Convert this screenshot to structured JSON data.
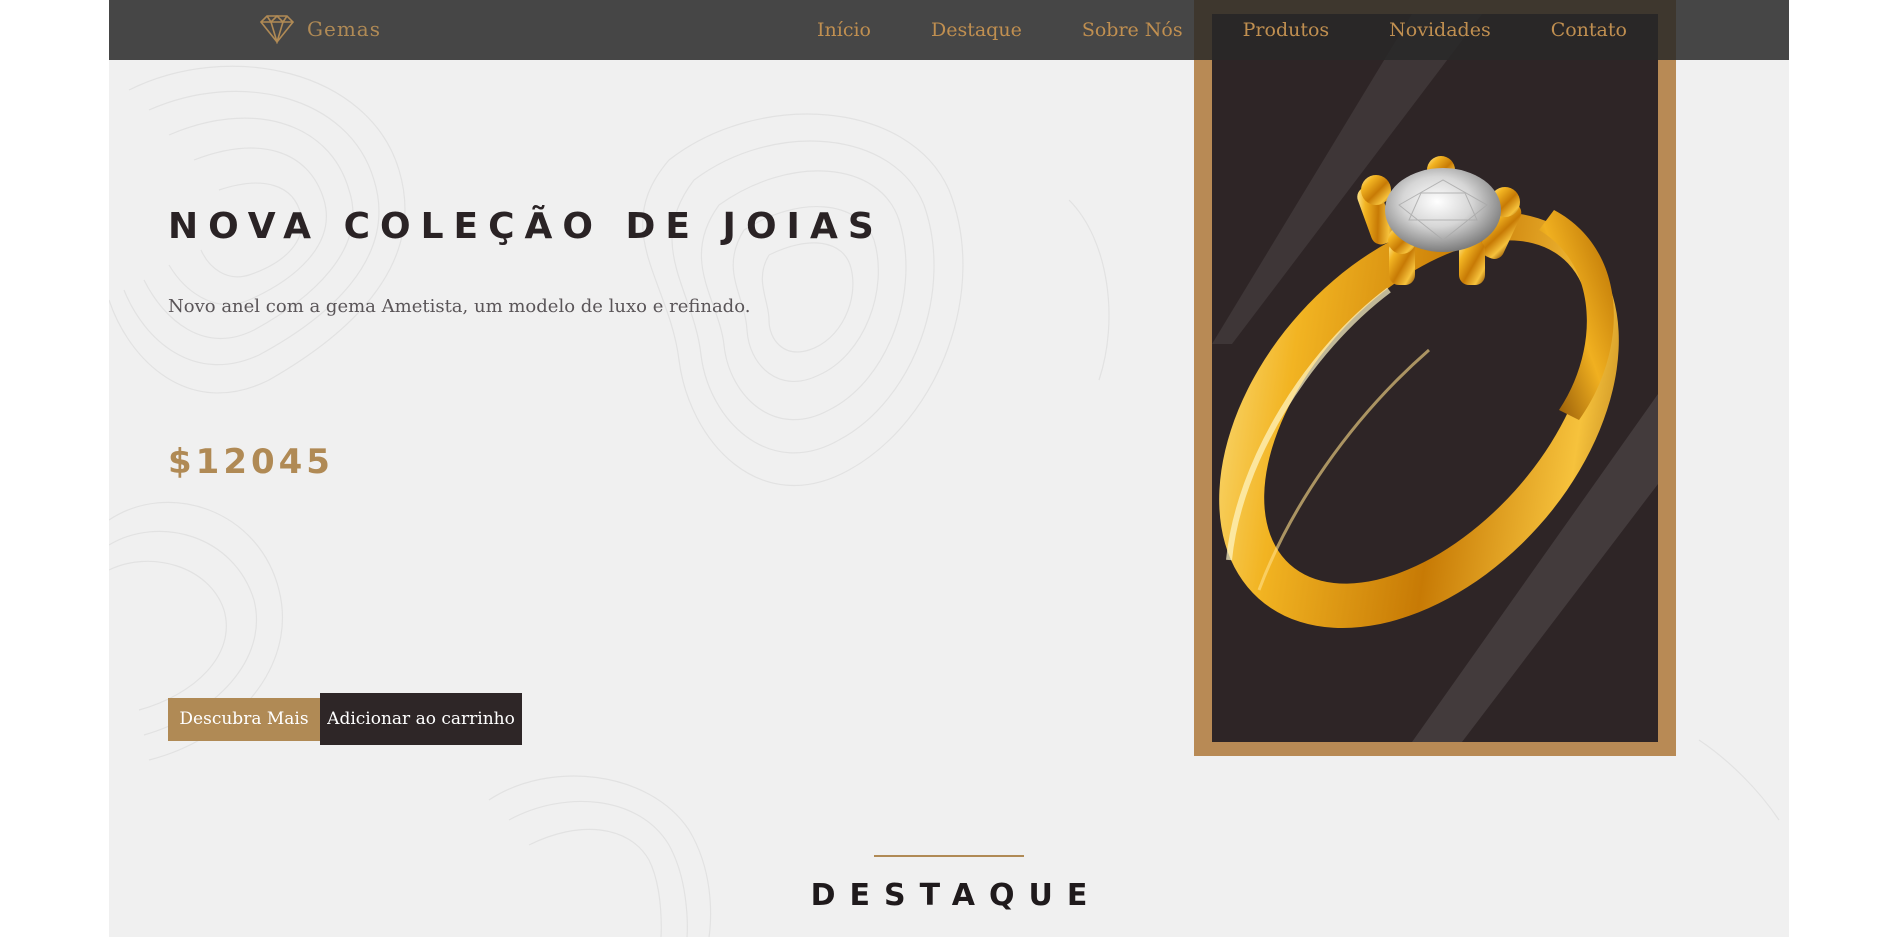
{
  "nav": {
    "brand": "Gemas",
    "brand_icon": "diamond-icon",
    "links": [
      "Início",
      "Destaque",
      "Sobre Nós",
      "Produtos",
      "Novidades",
      "Contato"
    ]
  },
  "hero": {
    "title": "NOVA COLEÇÃO DE JOIAS",
    "subtitle": "Novo anel com a gema Ametista, um modelo de luxo e refinado.",
    "price": "$12045",
    "btn_discover": "Descubra Mais",
    "btn_cart": "Adicionar ao carrinho"
  },
  "section": {
    "title": "DESTAQUE"
  },
  "colors": {
    "gold": "#b08a55",
    "dark": "#2e2627",
    "page_bg": "#f0f0f0"
  }
}
